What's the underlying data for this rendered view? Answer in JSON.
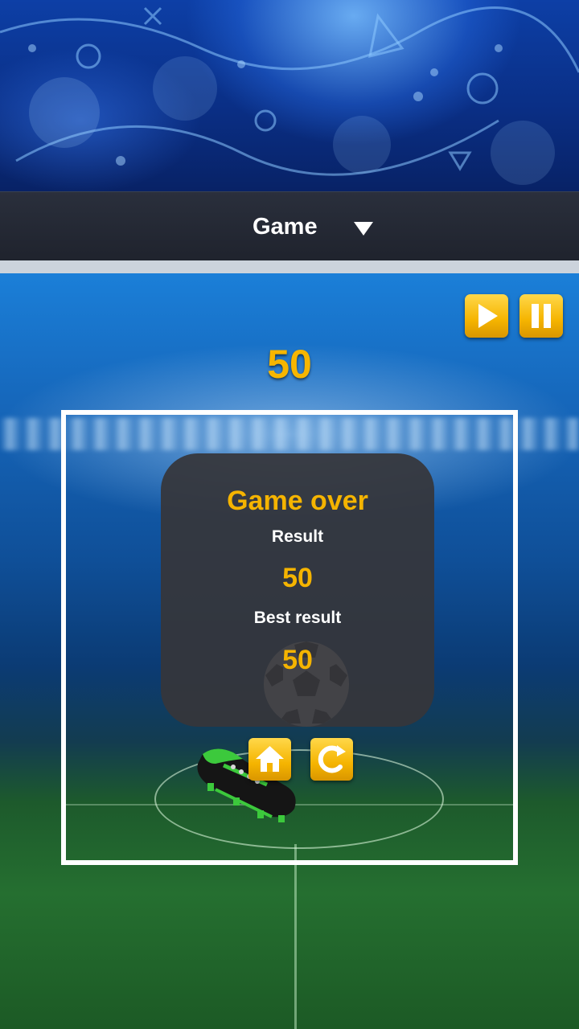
{
  "header": {
    "title": "Game",
    "dropdown_icon": "caret-down-icon"
  },
  "hud": {
    "score": "50",
    "play_icon": "play-icon",
    "pause_icon": "pause-icon"
  },
  "game_over": {
    "title": "Game over",
    "result_label": "Result",
    "result_value": "50",
    "best_label": "Best result",
    "best_value": "50"
  },
  "actions": {
    "home_icon": "home-icon",
    "restart_icon": "restart-icon"
  },
  "colors": {
    "accent": "#f5b400",
    "panel": "#363638",
    "frame": "#ffffff"
  }
}
